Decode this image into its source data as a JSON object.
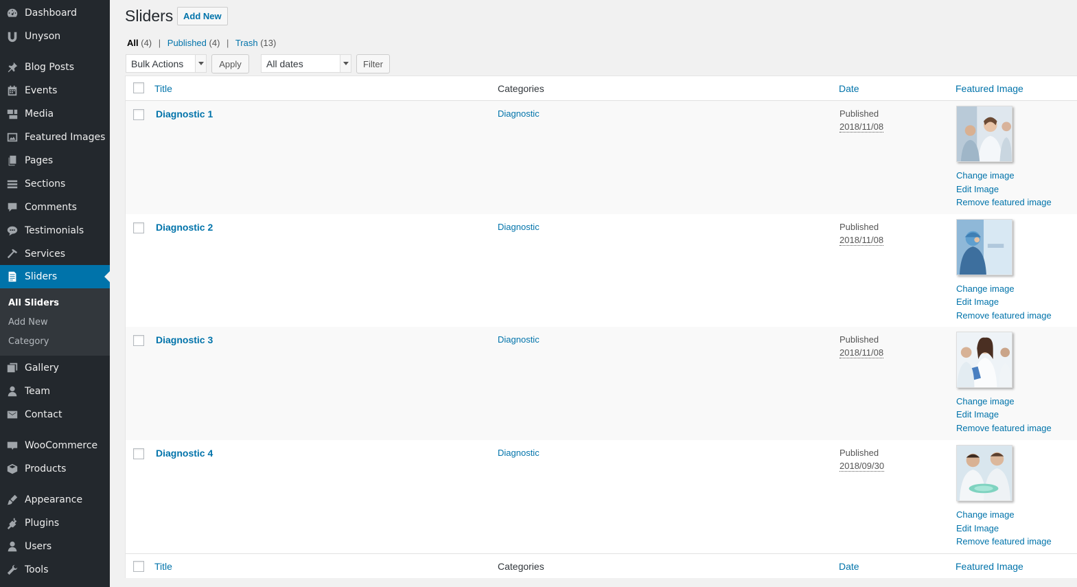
{
  "sidebar": {
    "items": [
      {
        "label": "Dashboard",
        "icon": "dashboard-icon"
      },
      {
        "label": "Unyson",
        "icon": "unyson-icon"
      },
      {
        "label": "Blog Posts",
        "icon": "pin-icon"
      },
      {
        "label": "Events",
        "icon": "calendar-icon"
      },
      {
        "label": "Media",
        "icon": "media-icon"
      },
      {
        "label": "Featured Images",
        "icon": "images-icon"
      },
      {
        "label": "Pages",
        "icon": "pages-icon"
      },
      {
        "label": "Sections",
        "icon": "sections-icon"
      },
      {
        "label": "Comments",
        "icon": "comment-icon"
      },
      {
        "label": "Testimonials",
        "icon": "testimonial-icon"
      },
      {
        "label": "Services",
        "icon": "hammer-icon"
      },
      {
        "label": "Sliders",
        "icon": "document-icon"
      },
      {
        "label": "Gallery",
        "icon": "gallery-icon"
      },
      {
        "label": "Team",
        "icon": "person-icon"
      },
      {
        "label": "Contact",
        "icon": "envelope-icon"
      },
      {
        "label": "WooCommerce",
        "icon": "woo-icon"
      },
      {
        "label": "Products",
        "icon": "box-icon"
      },
      {
        "label": "Appearance",
        "icon": "brush-icon"
      },
      {
        "label": "Plugins",
        "icon": "plug-icon"
      },
      {
        "label": "Users",
        "icon": "user-icon"
      },
      {
        "label": "Tools",
        "icon": "wrench-icon"
      }
    ],
    "submenu": [
      "All Sliders",
      "Add New",
      "Category"
    ]
  },
  "header": {
    "title": "Sliders",
    "add_new": "Add New"
  },
  "filters": {
    "all": "All",
    "all_count": "(4)",
    "published": "Published",
    "published_count": "(4)",
    "trash": "Trash",
    "trash_count": "(13)",
    "sep": "|",
    "bulk_actions": "Bulk Actions",
    "apply": "Apply",
    "all_dates": "All dates",
    "filter": "Filter"
  },
  "columns": {
    "title": "Title",
    "categories": "Categories",
    "date": "Date",
    "featured_image": "Featured Image"
  },
  "rows": [
    {
      "title": "Diagnostic 1",
      "category": "Diagnostic",
      "status": "Published",
      "date": "2018/11/08"
    },
    {
      "title": "Diagnostic 2",
      "category": "Diagnostic",
      "status": "Published",
      "date": "2018/11/08"
    },
    {
      "title": "Diagnostic 3",
      "category": "Diagnostic",
      "status": "Published",
      "date": "2018/11/08"
    },
    {
      "title": "Diagnostic 4",
      "category": "Diagnostic",
      "status": "Published",
      "date": "2018/09/30"
    }
  ],
  "image_actions": {
    "change": "Change image",
    "edit": "Edit Image",
    "remove": "Remove featured image"
  },
  "colors": {
    "sidebar_bg": "#23282d",
    "active_bg": "#0073aa",
    "link": "#0073aa"
  }
}
